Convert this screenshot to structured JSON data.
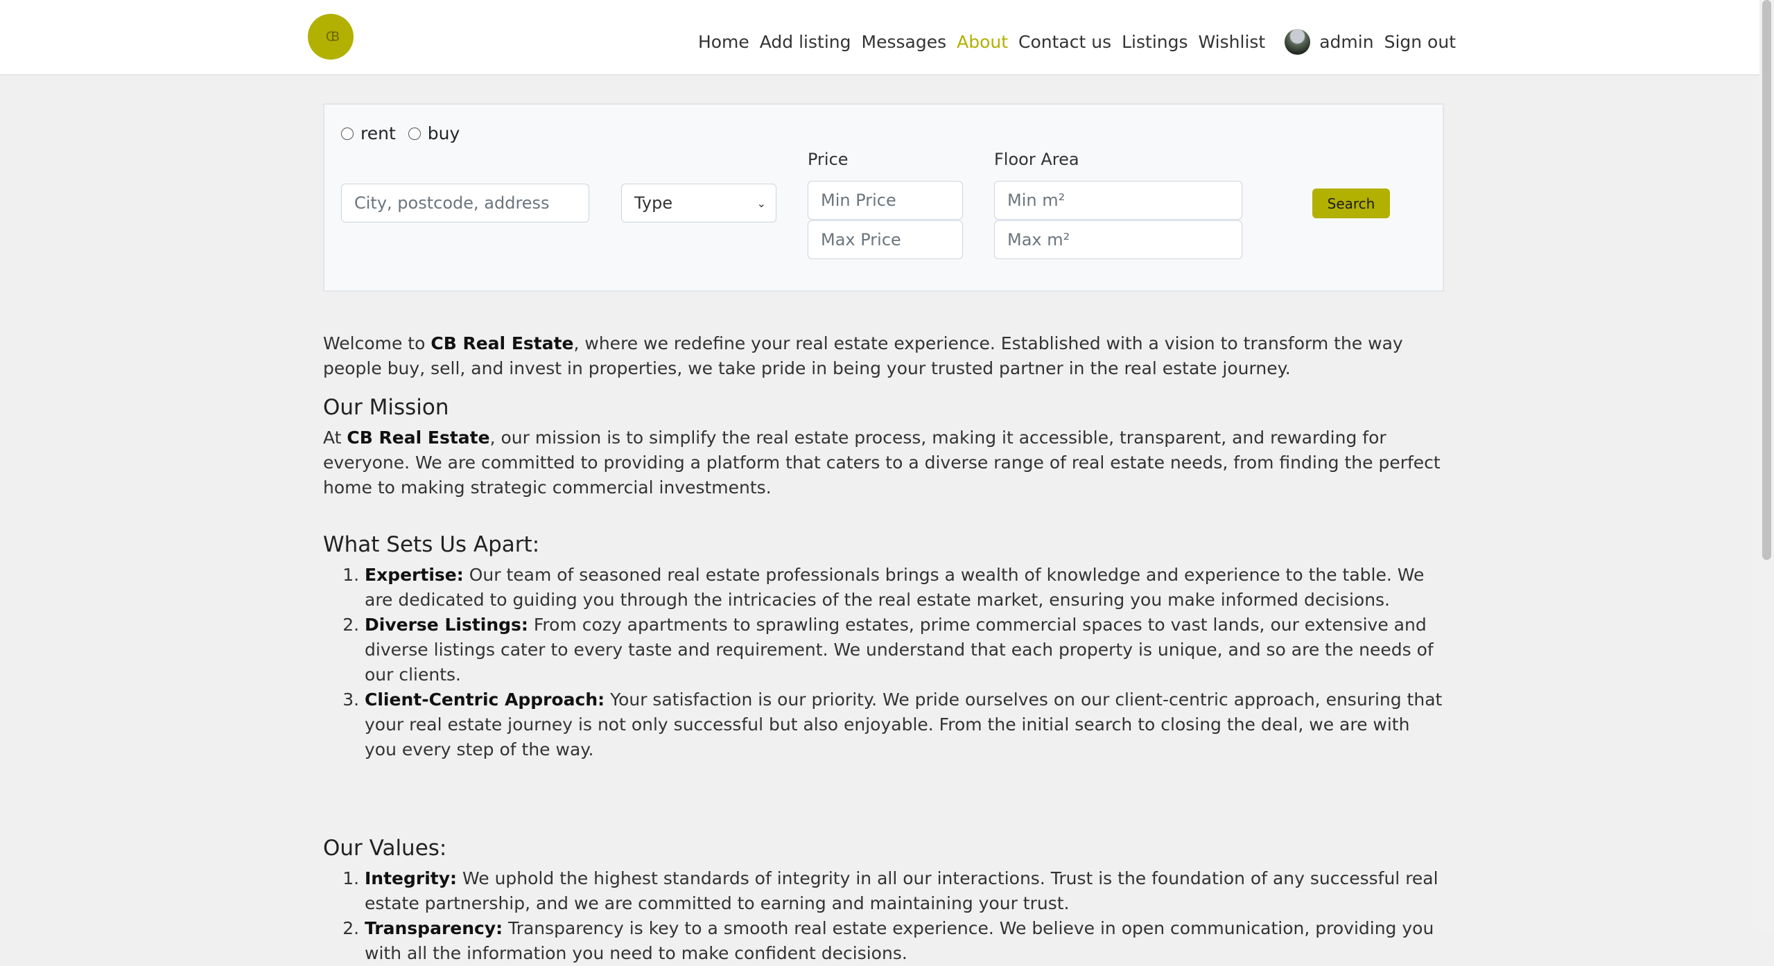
{
  "brand": {
    "logo_text": "CB",
    "color": "#b2b000"
  },
  "nav": {
    "links": [
      "Home",
      "Add listing",
      "Messages",
      "About",
      "Contact us",
      "Listings",
      "Wishlist"
    ],
    "active": "About",
    "user": "admin",
    "signout": "Sign out"
  },
  "search": {
    "radio_rent": "rent",
    "radio_buy": "buy",
    "location_placeholder": "City, postcode, address",
    "type_selected": "Type",
    "price_label": "Price",
    "min_price_placeholder": "Min Price",
    "max_price_placeholder": "Max Price",
    "area_label": "Floor Area",
    "min_area_placeholder": "Min m²",
    "max_area_placeholder": "Max m²",
    "button": "Search"
  },
  "about": {
    "intro_pre": "Welcome to ",
    "company": "CB Real Estate",
    "intro_post": ", where we redefine your real estate experience. Established with a vision to transform the way people buy, sell, and invest in properties, we take pride in being your trusted partner in the real estate journey.",
    "mission_title": "Our Mission",
    "mission_pre": "At ",
    "mission_post": ", our mission is to simplify the real estate process, making it accessible, transparent, and rewarding for everyone. We are committed to providing a platform that caters to a diverse range of real estate needs, from finding the perfect home to making strategic commercial investments.",
    "apart_title": "What Sets Us Apart:",
    "apart_items": [
      {
        "title": "Expertise:",
        "text": " Our team of seasoned real estate professionals brings a wealth of knowledge and experience to the table. We are dedicated to guiding you through the intricacies of the real estate market, ensuring you make informed decisions."
      },
      {
        "title": "Diverse Listings:",
        "text": " From cozy apartments to sprawling estates, prime commercial spaces to vast lands, our extensive and diverse listings cater to every taste and requirement. We understand that each property is unique, and so are the needs of our clients."
      },
      {
        "title": "Client-Centric Approach:",
        "text": " Your satisfaction is our priority. We pride ourselves on our client-centric approach, ensuring that your real estate journey is not only successful but also enjoyable. From the initial search to closing the deal, we are with you every step of the way."
      }
    ],
    "values_title": "Our Values:",
    "values_items": [
      {
        "title": "Integrity:",
        "text": " We uphold the highest standards of integrity in all our interactions. Trust is the foundation of any successful real estate partnership, and we are committed to earning and maintaining your trust."
      },
      {
        "title": "Transparency:",
        "text": " Transparency is key to a smooth real estate experience. We believe in open communication, providing you with all the information you need to make confident decisions."
      }
    ]
  }
}
